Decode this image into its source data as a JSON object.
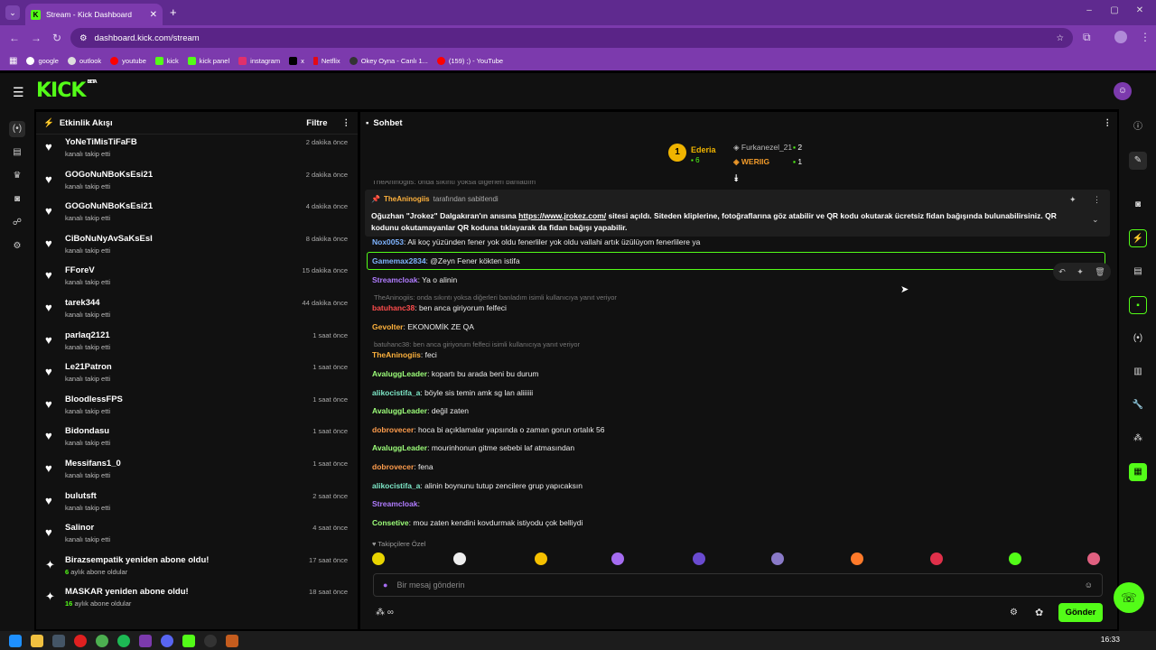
{
  "browser": {
    "tab_title": "Stream - Kick Dashboard",
    "tab_close": "✕",
    "new_tab": "+",
    "url": "dashboard.kick.com/stream",
    "window_controls": [
      "–",
      "▢",
      "✕"
    ],
    "bookmarks": [
      "google",
      "outlook",
      "youtube",
      "kick",
      "kick panel",
      "instagram",
      "x",
      "Netflix",
      "Okey Oyna - Canlı 1...",
      "(159) ;) - YouTube"
    ]
  },
  "kick": {
    "logo": "KICK",
    "beta": "BETA"
  },
  "activity": {
    "title": "Etkinlik Akışı",
    "filter": "Filtre",
    "items": [
      {
        "name": "YoNeTiMisTiFaFB",
        "sub": "kanalı takip etti",
        "time": "2 dakika önce"
      },
      {
        "name": "GOGoNuNBoKsEsi21",
        "sub": "kanalı takip etti",
        "time": "2 dakika önce"
      },
      {
        "name": "GOGoNuNBoKsEsi21",
        "sub": "kanalı takip etti",
        "time": "4 dakika önce"
      },
      {
        "name": "CiBoNuNyAvSaKsEsI",
        "sub": "kanalı takip etti",
        "time": "8 dakika önce"
      },
      {
        "name": "FForeV",
        "sub": "kanalı takip etti",
        "time": "15 dakika önce"
      },
      {
        "name": "tarek344",
        "sub": "kanalı takip etti",
        "time": "44 dakika önce"
      },
      {
        "name": "parlaq2121",
        "sub": "kanalı takip etti",
        "time": "1 saat önce"
      },
      {
        "name": "Le21Patron",
        "sub": "kanalı takip etti",
        "time": "1 saat önce"
      },
      {
        "name": "BloodlessFPS",
        "sub": "kanalı takip etti",
        "time": "1 saat önce"
      },
      {
        "name": "Bidondasu",
        "sub": "kanalı takip etti",
        "time": "1 saat önce"
      },
      {
        "name": "Messifans1_0",
        "sub": "kanalı takip etti",
        "time": "1 saat önce"
      },
      {
        "name": "bulutsft",
        "sub": "kanalı takip etti",
        "time": "2 saat önce"
      },
      {
        "name": "Salinor",
        "sub": "kanalı takip etti",
        "time": "4 saat önce"
      },
      {
        "name": "Birazsempatik yeniden abone oldu!",
        "sub_num": "6",
        "sub": "aylık abone oldular",
        "time": "17 saat önce"
      },
      {
        "name": "MASKAR yeniden abone oldu!",
        "sub_num": "16",
        "sub": "aylık abone oldular",
        "time": "18 saat önce"
      }
    ]
  },
  "chat": {
    "title": "Sohbet",
    "leaderboard": {
      "first": "Ederia",
      "first_count": "6",
      "second": "Furkanezel_21",
      "second_count": "2",
      "third": "WERIIG",
      "third_count": "1",
      "rank": "1"
    },
    "pinned": {
      "by_user": "TheAninogiis",
      "by_text": "tarafından sabitlendi",
      "text_before": "Oğuzhan \"Jrokez\" Dalgakıran'ın anısına ",
      "link": "https://www.jrokez.com/",
      "text_after": " sitesi açıldı. Siteden kliplerine, fotoğraflarına göz atabilir ve QR kodu okutarak ücretsiz fidan bağışında bulunabilirsiniz. QR kodunu okutamayanlar QR koduna tıklayarak da fidan bağışı yapabilir."
    },
    "partial_top": "TheAninogiis: onda sıkıntı yoksa diğerleri banladım",
    "messages": [
      {
        "user": "Nox0053",
        "text": "Ali koç yüzünden fener yok oldu fenerliler yok oldu vallahi artık üzülüyom fenerlilere ya",
        "color": "#7fb4ff"
      },
      {
        "user": "Gamemax2834",
        "text": "@Zeyn Fener kökten istifa",
        "color": "#7fb4ff"
      },
      {
        "user": "Streamcloak",
        "text": "Ya o alinin",
        "color": "#b07cff"
      },
      {
        "reply": "TheAninogiis: onda sıkıntı yoksa diğerleri banladım isimli kullanıcıya yanıt veriyor"
      },
      {
        "user": "batuhanc38",
        "text": "ben anca giriyorum felfeci",
        "color": "#ff4d4d"
      },
      {
        "user": "Gevolter",
        "text": "EKONOMİK ZE QA",
        "color": "#ffb23d"
      },
      {
        "reply": "batuhanc38: ben anca giriyorum felfeci isimli kullanıcıya yanıt veriyor"
      },
      {
        "user": "TheAninogiis",
        "text": "feci",
        "color": "#ffb23d"
      },
      {
        "user": "AvaluggLeader",
        "text": "kopartı bu arada beni bu durum",
        "color": "#9dff7a"
      },
      {
        "user": "alikocistifa_a",
        "text": "böyle sis temin amk sg lan aliiiiii",
        "color": "#7ee8c8"
      },
      {
        "user": "AvaluggLeader",
        "text": "değil zaten",
        "color": "#9dff7a"
      },
      {
        "user": "dobrovecer",
        "text": "hoca bi açıklamalar yapsında o zaman gorun ortalık 56",
        "color": "#ff9d4d"
      },
      {
        "user": "AvaluggLeader",
        "text": "mourinhonun gitme sebebi laf atmasından",
        "color": "#9dff7a"
      },
      {
        "user": "dobrovecer",
        "text": "fena",
        "color": "#ff9d4d"
      },
      {
        "user": "alikocistifa_a",
        "text": "alinin boynunu tutup zencilere grup yapıcaksın",
        "color": "#7ee8c8"
      },
      {
        "user": "Streamcloak",
        "text": "",
        "color": "#b07cff"
      },
      {
        "user": "Consetive",
        "text": "mou zaten kendini kovdurmak istiyodu çok belliydi",
        "color": "#9dff7a"
      }
    ],
    "emote_label": "Takipçilere Özel",
    "input_placeholder": "Bir mesaj gönderin",
    "send": "Gönder"
  },
  "taskbar": {
    "time": "16:33"
  }
}
